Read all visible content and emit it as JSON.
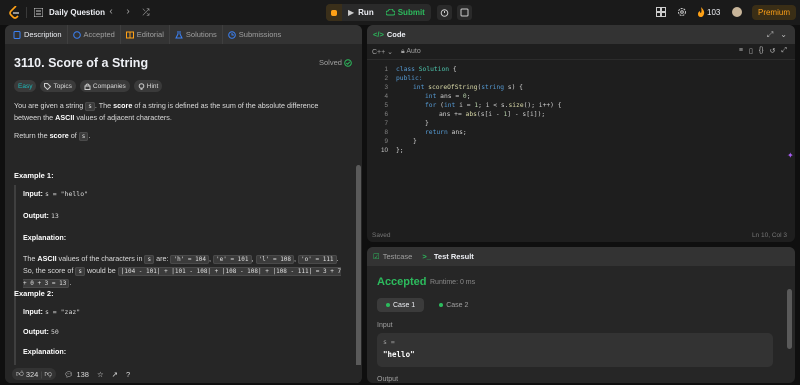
{
  "topbar": {
    "title": "Daily Question",
    "run_label": "Run",
    "submit_label": "Submit",
    "streak": "103",
    "premium_label": "Premium"
  },
  "tabs": [
    {
      "label": "Description",
      "active": true
    },
    {
      "label": "Accepted"
    },
    {
      "label": "Editorial"
    },
    {
      "label": "Solutions"
    },
    {
      "label": "Submissions"
    }
  ],
  "problem": {
    "title": "3110. Score of a String",
    "status": "Solved",
    "difficulty": "Easy",
    "chips": [
      "Topics",
      "Companies",
      "Hint"
    ],
    "para1_a": "You are given a string ",
    "para1_s": "s",
    "para1_b": ". The ",
    "para1_score": "score",
    "para1_c": " of a string is defined as the sum of the absolute difference between the ",
    "para1_ascii": "ASCII",
    "para1_d": " values of adjacent characters.",
    "para2_a": "Return the ",
    "para2_score": "score",
    "para2_b": " of ",
    "para2_s": "s",
    "para2_c": ".",
    "example1": {
      "heading": "Example 1:",
      "input_label": "Input:",
      "input_value": "s = \"hello\"",
      "output_label": "Output:",
      "output_value": "13",
      "explanation_label": "Explanation:",
      "exp_a": "The ",
      "exp_ascii": "ASCII",
      "exp_b": " values of the characters in ",
      "exp_s": "s",
      "exp_c": " are: ",
      "exp_h": "'h' = 104",
      "exp_e": "'e' = 101",
      "exp_l": "'l' = 108",
      "exp_o": "'o' = 111",
      "exp_d": ". So, the score of ",
      "exp_s2": "s",
      "exp_e2": " would be ",
      "exp_formula": "|104 - 101| + |101 - 108| + |108 - 108| + |108 - 111| = 3 + 7 + 0 + 3 = 13",
      "exp_end": "."
    },
    "example2": {
      "heading": "Example 2:",
      "input_label": "Input:",
      "input_value": "s = \"zaz\"",
      "output_label": "Output:",
      "output_value": "50",
      "explanation_label": "Explanation:"
    }
  },
  "footer": {
    "likes": "324",
    "comments": "138"
  },
  "editor": {
    "header": "Code",
    "language": "C++",
    "auto_label": "Auto",
    "lines": [
      "1",
      "2",
      "3",
      "4",
      "5",
      "6",
      "7",
      "8",
      "9",
      "10"
    ],
    "status_saved": "Saved",
    "cursor": "Ln 10, Col 3"
  },
  "code": {
    "l1_kw": "class",
    "l1_ty": "Solution",
    "l1_rest": " {",
    "l2": "public:",
    "l3_ty": "int",
    "l3_fn": "scoreOfString",
    "l3_a": "(",
    "l3_ty2": "string",
    "l3_b": " s) {",
    "l4_ty": "int",
    "l4_rest": " ans = ",
    "l4_num": "0",
    "l4_end": ";",
    "l5_kw": "for",
    "l5_a": " (",
    "l5_ty": "int",
    "l5_b": " i = ",
    "l5_n1": "1",
    "l5_c": "; i < s.",
    "l5_fn": "size",
    "l5_d": "(); i++) {",
    "l6_a": "ans += ",
    "l6_fn": "abs",
    "l6_b": "(s[i - ",
    "l6_n": "1",
    "l6_c": "] - s[i]);",
    "l7": "}",
    "l8_kw": "return",
    "l8_rest": " ans;",
    "l9": "}",
    "l10": "};"
  },
  "test": {
    "tab_testcase": "Testcase",
    "tab_result": "Test Result",
    "verdict": "Accepted",
    "runtime": "Runtime: 0 ms",
    "case1": "Case 1",
    "case2": "Case 2",
    "input_label": "Input",
    "var_name": "s =",
    "var_value": "\"hello\"",
    "output_label": "Output"
  },
  "colors": {
    "accent_green": "#2cbb5d",
    "accent_orange": "#ffa116",
    "easy": "#1cbaba"
  }
}
